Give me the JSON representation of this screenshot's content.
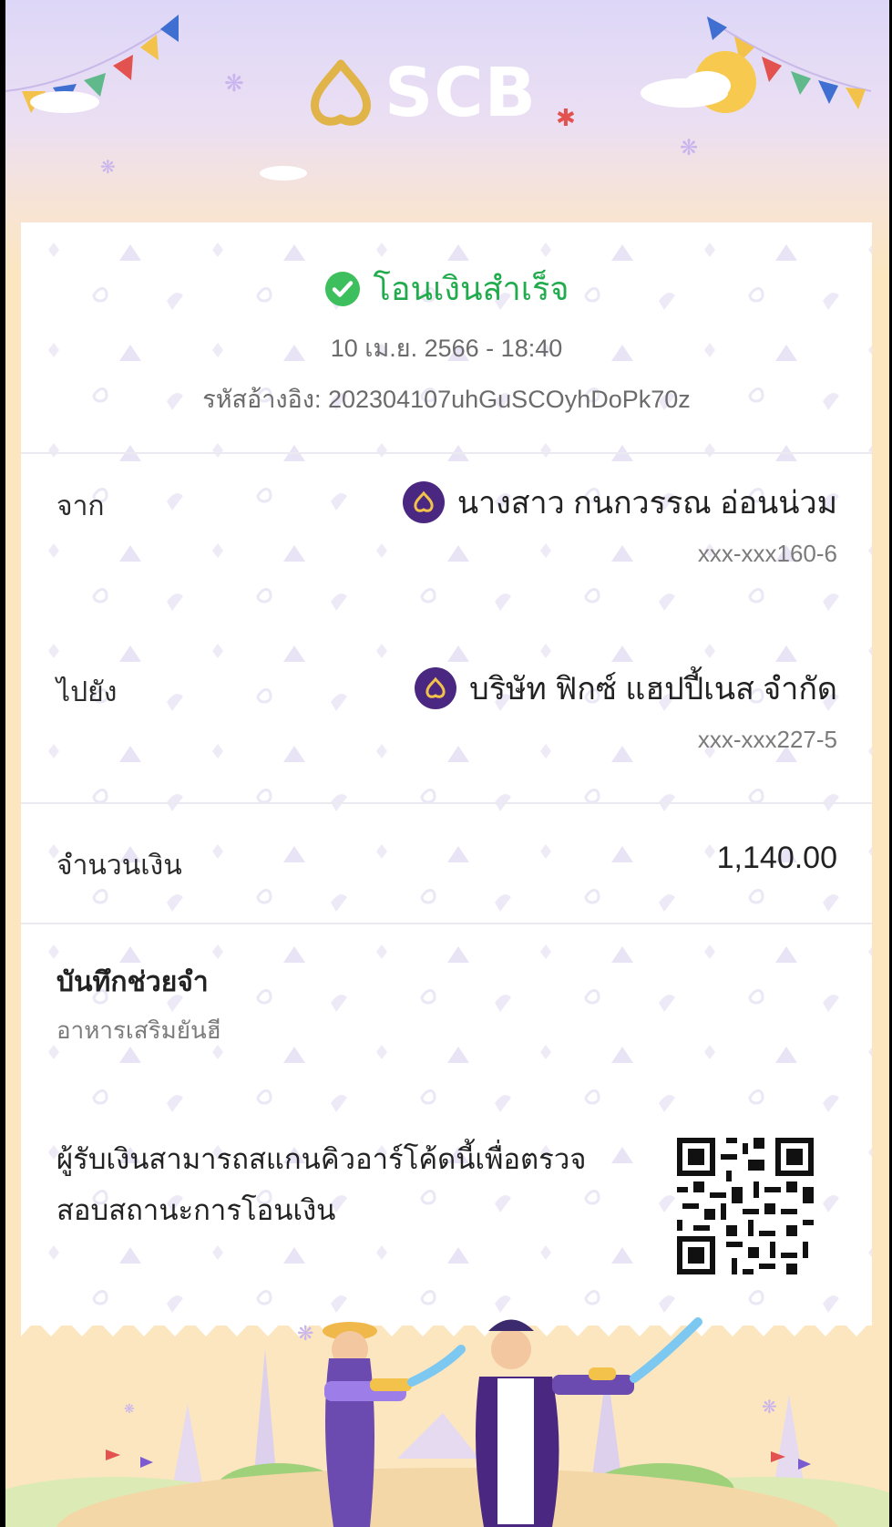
{
  "header": {
    "logo_text": "SCB",
    "logo_icon": "scb-lotus-icon"
  },
  "status": {
    "icon": "check-circle-icon",
    "text": "โอนเงินสำเร็จ",
    "color": "#22ab4d"
  },
  "transaction": {
    "datetime": "10 เม.ย. 2566 - 18:40",
    "ref_label": "รหัสอ้างอิง:",
    "ref_value": "202304107uhGuSCOyhDoPk70z"
  },
  "from": {
    "label": "จาก",
    "name": "นางสาว กนกวรรณ อ่อนน่วม",
    "account": "xxx-xxx160-6",
    "bank_icon": "scb-bank-icon"
  },
  "to": {
    "label": "ไปยัง",
    "name": "บริษัท ฟิกซ์ แฮปปี้เนส จำกัด",
    "account": "xxx-xxx227-5",
    "bank_icon": "scb-bank-icon"
  },
  "amount": {
    "label": "จำนวนเงิน",
    "value": "1,140.00"
  },
  "memo": {
    "label": "บันทึกช่วยจำ",
    "value": "อาหารเสริมยันฮี"
  },
  "verify": {
    "text": "ผู้รับเงินสามารถสแกนคิวอาร์โค้ดนี้เพื่อตรวจสอบสถานะการโอนเงิน",
    "qr_icon": "qr-code-icon"
  },
  "colors": {
    "brand_purple": "#4a2881",
    "brand_gold": "#d9a93a",
    "success_green": "#22ab4d"
  }
}
